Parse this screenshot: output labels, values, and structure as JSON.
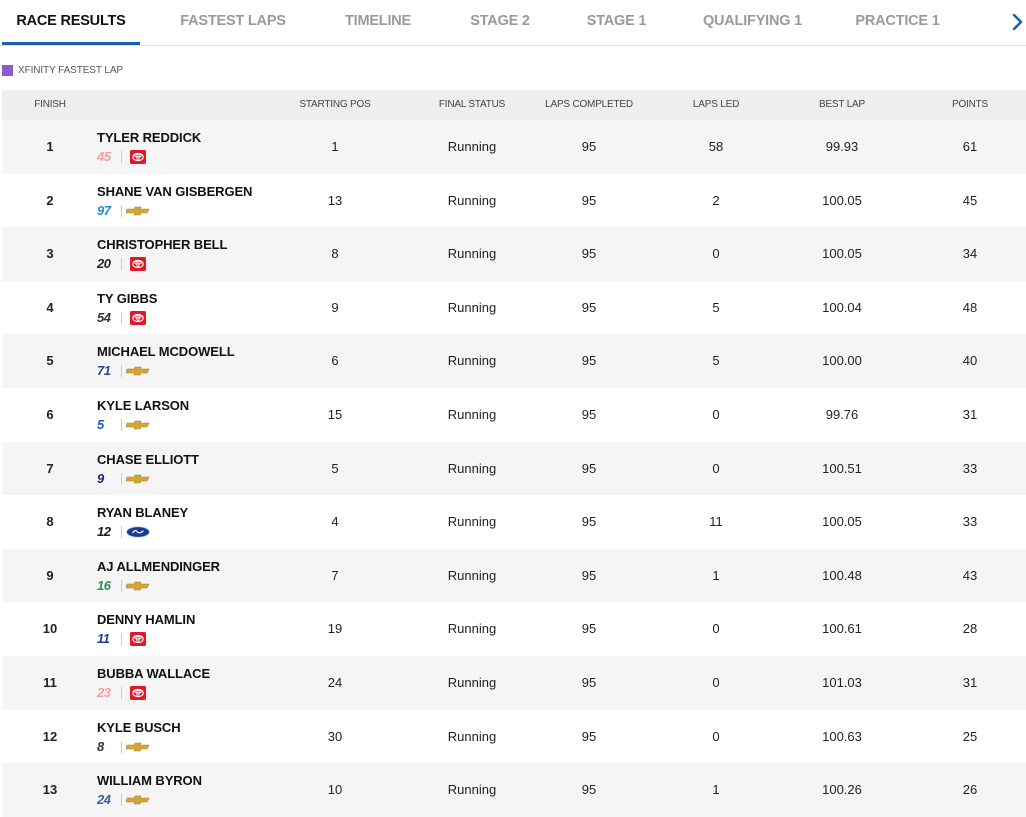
{
  "tabs": [
    {
      "label": "RACE RESULTS",
      "active": true
    },
    {
      "label": "FASTEST LAPS",
      "active": false
    },
    {
      "label": "TIMELINE",
      "active": false
    },
    {
      "label": "STAGE 2",
      "active": false
    },
    {
      "label": "STAGE 1",
      "active": false
    },
    {
      "label": "QUALIFYING 1",
      "active": false
    },
    {
      "label": "PRACTICE 1",
      "active": false
    }
  ],
  "legend": {
    "label": "XFINITY FASTEST LAP",
    "color": "#8a5cc9"
  },
  "table": {
    "headers": {
      "finish": "FINISH",
      "starting_pos": "STARTING POS",
      "final_status": "FINAL STATUS",
      "laps_completed": "LAPS COMPLETED",
      "laps_led": "LAPS LED",
      "best_lap": "BEST LAP",
      "points": "POINTS"
    },
    "rows": [
      {
        "finish": "1",
        "driver": "TYLER REDDICK",
        "car_number": "45",
        "number_color": "#f5a0a8",
        "make": "toyota",
        "starting_pos": "1",
        "final_status": "Running",
        "laps_completed": "95",
        "laps_led": "58",
        "best_lap": "99.93",
        "points": "61"
      },
      {
        "finish": "2",
        "driver": "SHANE VAN GISBERGEN",
        "car_number": "97",
        "number_color": "#1e8fc8",
        "make": "chevrolet",
        "starting_pos": "13",
        "final_status": "Running",
        "laps_completed": "95",
        "laps_led": "2",
        "best_lap": "100.05",
        "points": "45"
      },
      {
        "finish": "3",
        "driver": "CHRISTOPHER BELL",
        "car_number": "20",
        "number_color": "#222222",
        "make": "toyota",
        "starting_pos": "8",
        "final_status": "Running",
        "laps_completed": "95",
        "laps_led": "0",
        "best_lap": "100.05",
        "points": "34"
      },
      {
        "finish": "4",
        "driver": "TY GIBBS",
        "car_number": "54",
        "number_color": "#333333",
        "make": "toyota",
        "starting_pos": "9",
        "final_status": "Running",
        "laps_completed": "95",
        "laps_led": "5",
        "best_lap": "100.04",
        "points": "48"
      },
      {
        "finish": "5",
        "driver": "MICHAEL MCDOWELL",
        "car_number": "71",
        "number_color": "#2b4a8a",
        "make": "chevrolet",
        "starting_pos": "6",
        "final_status": "Running",
        "laps_completed": "95",
        "laps_led": "5",
        "best_lap": "100.00",
        "points": "40"
      },
      {
        "finish": "6",
        "driver": "KYLE LARSON",
        "car_number": "5",
        "number_color": "#1f5fb5",
        "make": "chevrolet",
        "starting_pos": "15",
        "final_status": "Running",
        "laps_completed": "95",
        "laps_led": "0",
        "best_lap": "99.76",
        "points": "31"
      },
      {
        "finish": "7",
        "driver": "CHASE ELLIOTT",
        "car_number": "9",
        "number_color": "#1b2a6b",
        "make": "chevrolet",
        "starting_pos": "5",
        "final_status": "Running",
        "laps_completed": "95",
        "laps_led": "0",
        "best_lap": "100.51",
        "points": "33"
      },
      {
        "finish": "8",
        "driver": "RYAN BLANEY",
        "car_number": "12",
        "number_color": "#1a1a1a",
        "make": "ford",
        "starting_pos": "4",
        "final_status": "Running",
        "laps_completed": "95",
        "laps_led": "11",
        "best_lap": "100.05",
        "points": "33"
      },
      {
        "finish": "9",
        "driver": "AJ ALLMENDINGER",
        "car_number": "16",
        "number_color": "#2e8b57",
        "make": "chevrolet",
        "starting_pos": "7",
        "final_status": "Running",
        "laps_completed": "95",
        "laps_led": "1",
        "best_lap": "100.48",
        "points": "43"
      },
      {
        "finish": "10",
        "driver": "DENNY HAMLIN",
        "car_number": "11",
        "number_color": "#1f3f8a",
        "make": "toyota",
        "starting_pos": "19",
        "final_status": "Running",
        "laps_completed": "95",
        "laps_led": "0",
        "best_lap": "100.61",
        "points": "28"
      },
      {
        "finish": "11",
        "driver": "BUBBA WALLACE",
        "car_number": "23",
        "number_color": "#f2a0a0",
        "make": "toyota",
        "starting_pos": "24",
        "final_status": "Running",
        "laps_completed": "95",
        "laps_led": "0",
        "best_lap": "101.03",
        "points": "31"
      },
      {
        "finish": "12",
        "driver": "KYLE BUSCH",
        "car_number": "8",
        "number_color": "#333333",
        "make": "chevrolet",
        "starting_pos": "30",
        "final_status": "Running",
        "laps_completed": "95",
        "laps_led": "0",
        "best_lap": "100.63",
        "points": "25"
      },
      {
        "finish": "13",
        "driver": "WILLIAM BYRON",
        "car_number": "24",
        "number_color": "#3b5aa8",
        "make": "chevrolet",
        "starting_pos": "10",
        "final_status": "Running",
        "laps_completed": "95",
        "laps_led": "1",
        "best_lap": "100.26",
        "points": "26"
      }
    ]
  },
  "icons": {
    "next_tabs": "chevron-right-icon",
    "toyota": "toyota-logo-icon",
    "chevrolet": "chevrolet-bowtie-icon",
    "ford": "ford-oval-icon"
  },
  "colors": {
    "tab_active_underline": "#1a5fa8",
    "tab_inactive": "#9a9a9a",
    "header_bg": "#eeeeee",
    "row_alt_bg": "#f5f5f5",
    "toyota_red": "#e0192a",
    "chevy_gold": "#d4a63a",
    "ford_blue": "#1b3d8f"
  }
}
